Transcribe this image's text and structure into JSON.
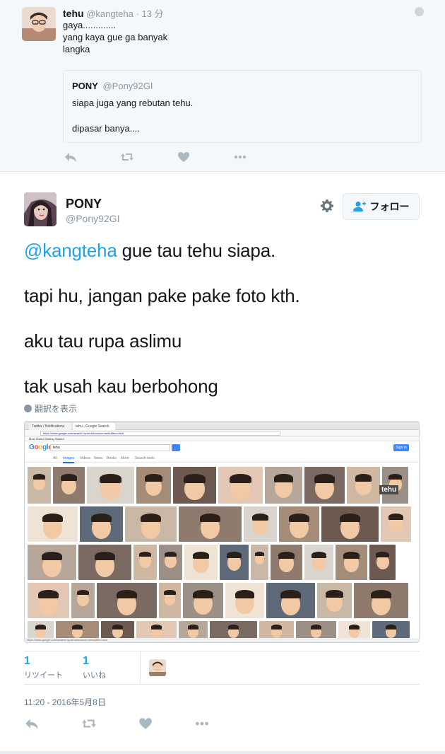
{
  "parent_tweet": {
    "name": "tehu",
    "handle": "@kangteha",
    "time": "13 分",
    "lines": [
      "gaya.............",
      "yang kaya gue ga banyak",
      "langka"
    ],
    "quoted": {
      "name": "PONY",
      "handle": "@Pony92GI",
      "line1": "siapa juga yang rebutan tehu.",
      "line2": "dipasar banya...."
    },
    "actions": [
      "reply-icon",
      "retweet-icon",
      "like-icon",
      "more-icon"
    ]
  },
  "main_tweet": {
    "name": "PONY",
    "handle": "@Pony92GI",
    "follow_label": "フォロー",
    "mention": "@kangteha",
    "line1_rest": " gue tau tehu siapa.",
    "line2": "tapi hu, jangan pake pake foto kth.",
    "line3": "aku tau rupa aslimu",
    "line4": "tak usah kau berbohong",
    "translate_label": "翻訳を表示",
    "media": {
      "tab1": "Twitter / Notifications",
      "tab2": "tehu - Google Search",
      "url": "https://www.google.com/search?q=tehu&source=lnms&tbm=isch",
      "bookmarks": "Most Visited   Getting Started",
      "logo": "Google",
      "query": "tehu",
      "sign_in": "Sign in",
      "search_tabs": [
        "All",
        "Images",
        "Videos",
        "News",
        "Books",
        "More",
        "Search tools"
      ],
      "banner_text": "tehu"
    },
    "stats": {
      "retweets": "1",
      "retweets_label": "リツイート",
      "likes": "1",
      "likes_label": "いいね"
    },
    "timestamp": "11:20 - 2016年5月8日",
    "actions": [
      "reply-icon",
      "retweet-icon",
      "like-icon",
      "more-icon"
    ]
  },
  "colors": {
    "link": "#1da1f2",
    "muted": "#8899a6",
    "action_icon": "#aab8c2"
  }
}
